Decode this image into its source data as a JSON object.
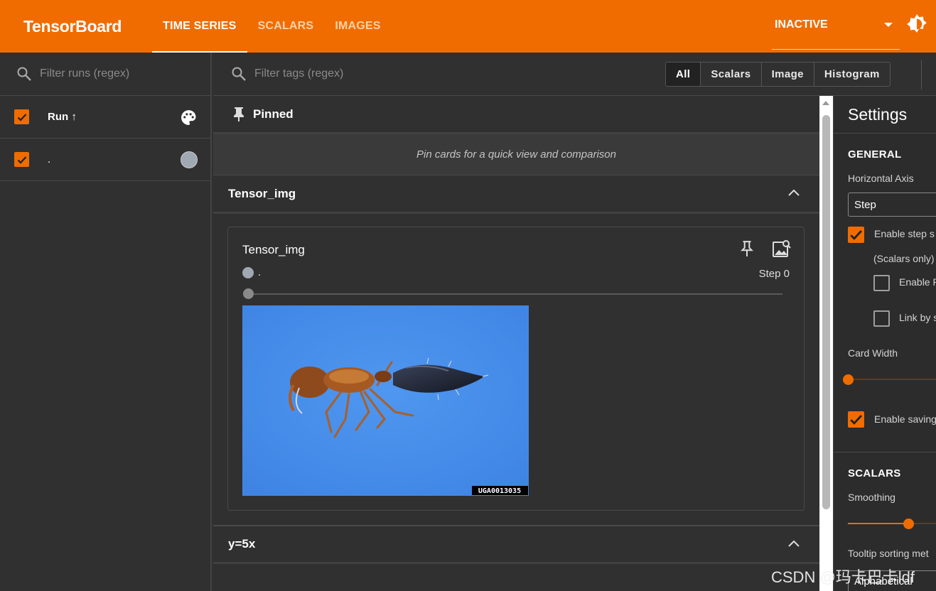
{
  "header": {
    "brand": "TensorBoard",
    "tabs": [
      {
        "label": "TIME SERIES",
        "active": true
      },
      {
        "label": "SCALARS",
        "active": false
      },
      {
        "label": "IMAGES",
        "active": false
      }
    ],
    "run_status": "INACTIVE"
  },
  "runs": {
    "filter_placeholder": "Filter runs (regex)",
    "header_label": "Run ↑",
    "items": [
      {
        "label": ".",
        "checked": true,
        "color": "#a0a8b4"
      }
    ]
  },
  "toolbar": {
    "filter_placeholder": "Filter tags (regex)",
    "type_filters": [
      "All",
      "Scalars",
      "Image",
      "Histogram"
    ],
    "selected_type": "All"
  },
  "pinned": {
    "title": "Pinned",
    "empty_text": "Pin cards for a quick view and comparison"
  },
  "groups": [
    {
      "name": "Tensor_img",
      "card": {
        "title": "Tensor_img",
        "run": ".",
        "step_label": "Step 0",
        "image_caption": "UGA0013035"
      }
    },
    {
      "name": "y=5x"
    }
  ],
  "settings": {
    "title": "Settings",
    "general": "GENERAL",
    "horizontal_axis_label": "Horizontal Axis",
    "horizontal_axis_value": "Step",
    "enable_step_selection": "Enable step s",
    "scalars_only": "(Scalars only)",
    "enable_range": "Enable R",
    "link_by_step": "Link by s",
    "card_width": "Card Width",
    "enable_saving": "Enable saving",
    "scalars": "SCALARS",
    "smoothing": "Smoothing",
    "smoothing_value": 0.6,
    "tooltip_sorting": "Tooltip sorting met",
    "tooltip_sorting_value": "Alphabetical"
  },
  "watermark": "CSDN @玛卡巴卡ldf",
  "colors": {
    "accent": "#f06c00",
    "background": "#303030"
  }
}
